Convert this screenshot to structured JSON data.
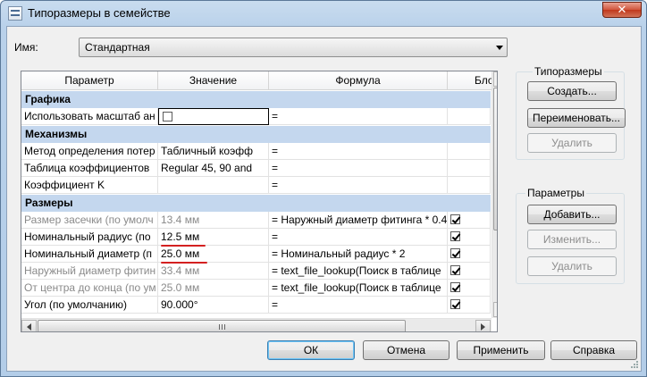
{
  "window": {
    "title": "Типоразмеры в семействе",
    "close_label": "✕"
  },
  "name_field": {
    "label": "Имя:",
    "value": "Стандартная"
  },
  "grid": {
    "columns": [
      "Параметр",
      "Значение",
      "Формула",
      "Бло"
    ],
    "groups": [
      {
        "title": "Графика",
        "rows": [
          {
            "param": "Использовать масштаб ан",
            "value": "",
            "formula": "=",
            "checkbox": "unchecked",
            "lock": "",
            "muted": false
          }
        ]
      },
      {
        "title": "Механизмы",
        "rows": [
          {
            "param": "Метод определения потер",
            "value": "Табличный коэфф",
            "formula": "=",
            "lock": "",
            "muted": false
          },
          {
            "param": "Таблица коэффициентов",
            "value": "Regular 45, 90 and",
            "formula": "=",
            "lock": "",
            "muted": false
          },
          {
            "param": "Коэффициент K",
            "value": "",
            "formula": "=",
            "lock": "",
            "muted": false
          }
        ]
      },
      {
        "title": "Размеры",
        "rows": [
          {
            "param": "Размер засечки (по умолч",
            "value": "13.4 мм",
            "formula": "= Наружный диаметр фитинга * 0.4",
            "lock": "checked",
            "muted": true
          },
          {
            "param": "Номинальный радиус (по",
            "value": "12.5 мм",
            "formula": "=",
            "lock": "checked",
            "muted": false
          },
          {
            "param": "Номинальный диаметр (п",
            "value": "25.0 мм",
            "formula": "= Номинальный радиус * 2",
            "lock": "checked",
            "muted": false
          },
          {
            "param": "Наружный диаметр фитин",
            "value": "33.4 мм",
            "formula": "= text_file_lookup(Поиск в таблице",
            "lock": "checked",
            "muted": true
          },
          {
            "param": "От центра до конца (по ум",
            "value": "25.0 мм",
            "formula": "= text_file_lookup(Поиск в таблице",
            "lock": "checked",
            "muted": true
          },
          {
            "param": "Угол (по умолчанию)",
            "value": "90.000°",
            "formula": "=",
            "lock": "checked",
            "muted": false
          }
        ]
      }
    ]
  },
  "types_panel": {
    "legend": "Типоразмеры",
    "create_label": "Создать...",
    "rename_label": "Переименовать...",
    "delete_label": "Удалить"
  },
  "params_panel": {
    "legend": "Параметры",
    "add_label": "Добавить...",
    "modify_label": "Изменить...",
    "delete_label": "Удалить"
  },
  "footer": {
    "ok_label": "ОК",
    "cancel_label": "Отмена",
    "apply_label": "Применить",
    "help_label": "Справка"
  },
  "colors": {
    "group_header": "#c4d7ee",
    "muted_text": "#8a8a8a",
    "annotation_underline": "#d42020"
  }
}
